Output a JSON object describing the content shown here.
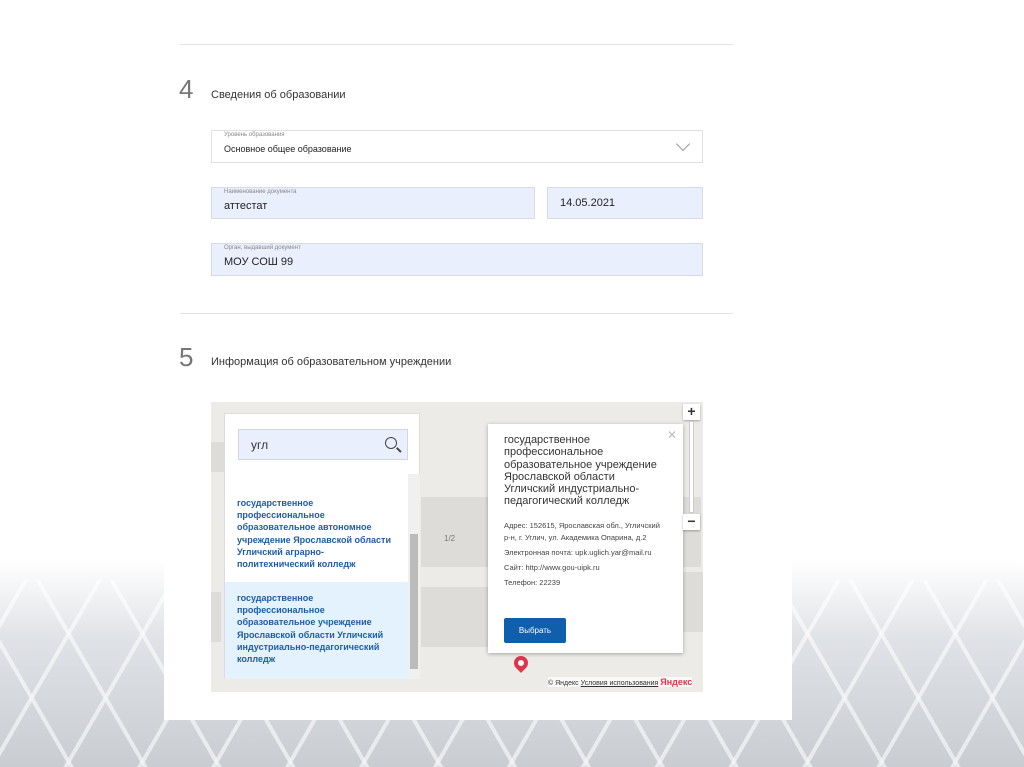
{
  "section4": {
    "number": "4",
    "title": "Сведения об образовании",
    "level": {
      "label": "Уровень образования",
      "value": "Основное общее образование"
    },
    "doc_name": {
      "label": "Наименование документа",
      "value": "аттестат"
    },
    "doc_date": {
      "value": "14.05.2021"
    },
    "issuer": {
      "label": "Орган, выдавший документ",
      "value": "МОУ СОШ 99"
    }
  },
  "section5": {
    "number": "5",
    "title": "Информация об образовательном учреждении",
    "search": {
      "value": "угл"
    },
    "results": [
      "государственное профессиональное образовательное автономное учреждение Ярославской области Угличский аграрно-политехнический колледж",
      "государственное профессиональное образовательное учреждение Ярославской области Угличский индустриально-педагогический колледж"
    ],
    "map_label": "1/2",
    "popup": {
      "title": "государственное профессиональное образовательное учреждение Ярославской области Угличский индустриально-педагогический колледж",
      "address": "Адрес: 152615, Ярославская обл., Угличский р-н, г. Углич, ул. Академика Опарина, д.2",
      "email": "Электронная почта: upk.uglich.yar@mail.ru",
      "site": "Сайт: http://www.gou-uipk.ru",
      "phone": "Телефон: 22239",
      "button": "Выбрать"
    },
    "zoom_in": "+",
    "zoom_out": "−",
    "footer": {
      "copyright": "© Яндекс",
      "terms": "Условия использования",
      "logo": "Яндекс"
    }
  }
}
